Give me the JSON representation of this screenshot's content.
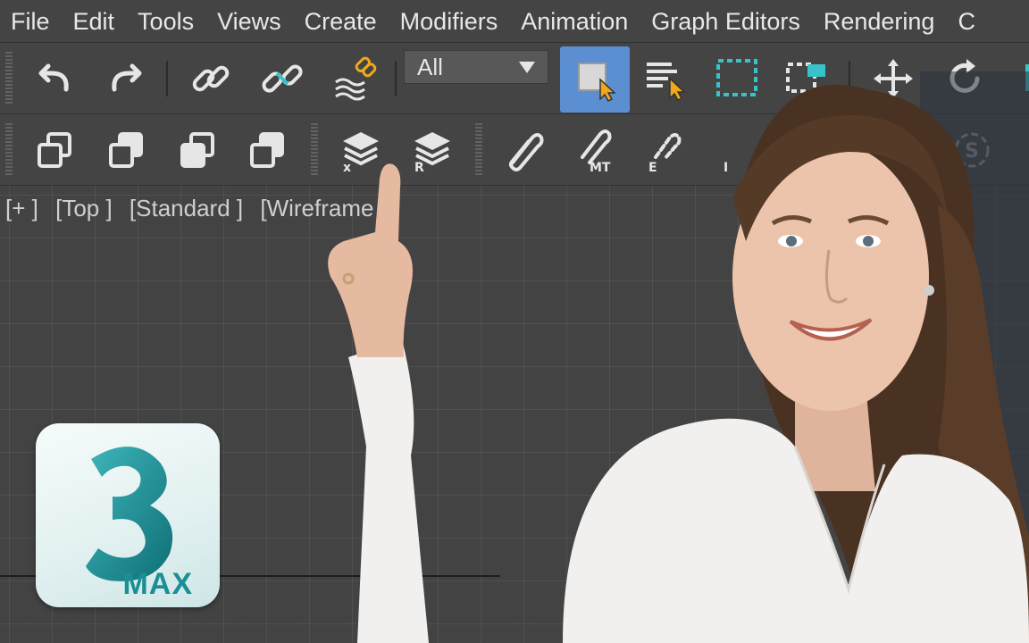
{
  "menubar": {
    "items": [
      "File",
      "Edit",
      "Tools",
      "Views",
      "Create",
      "Modifiers",
      "Animation",
      "Graph Editors",
      "Rendering",
      "C"
    ]
  },
  "toolbar1": {
    "selection_filter": {
      "value": "All"
    },
    "icons": [
      "undo-icon",
      "redo-icon",
      "link-icon",
      "unlink-icon",
      "bind-to-space-warp-icon",
      "select-object-icon",
      "select-by-name-icon",
      "rectangular-selection-region-icon",
      "window-crossing-icon",
      "select-and-move-icon",
      "select-and-rotate-icon"
    ]
  },
  "toolbar2": {
    "icons": [
      "clone-icon-1",
      "clone-icon-2",
      "clone-icon-3",
      "clone-icon-4",
      "layer-x-icon",
      "layer-r-icon",
      "paperclip-icon",
      "paperclip-mt-icon",
      "paperclip-e-icon",
      "paperclip-i-icon",
      "s-icon"
    ]
  },
  "viewport": {
    "label_parts": [
      "[+ ]",
      "[Top ]",
      "[Standard ]",
      "[Wireframe ]"
    ]
  },
  "logo": {
    "digit": "3",
    "word": "MAX",
    "accent_color": "#1a8f95"
  },
  "colors": {
    "ui_background": "#444444",
    "active_button": "#5b8fd1",
    "cursor_accent": "#f0a81c"
  }
}
